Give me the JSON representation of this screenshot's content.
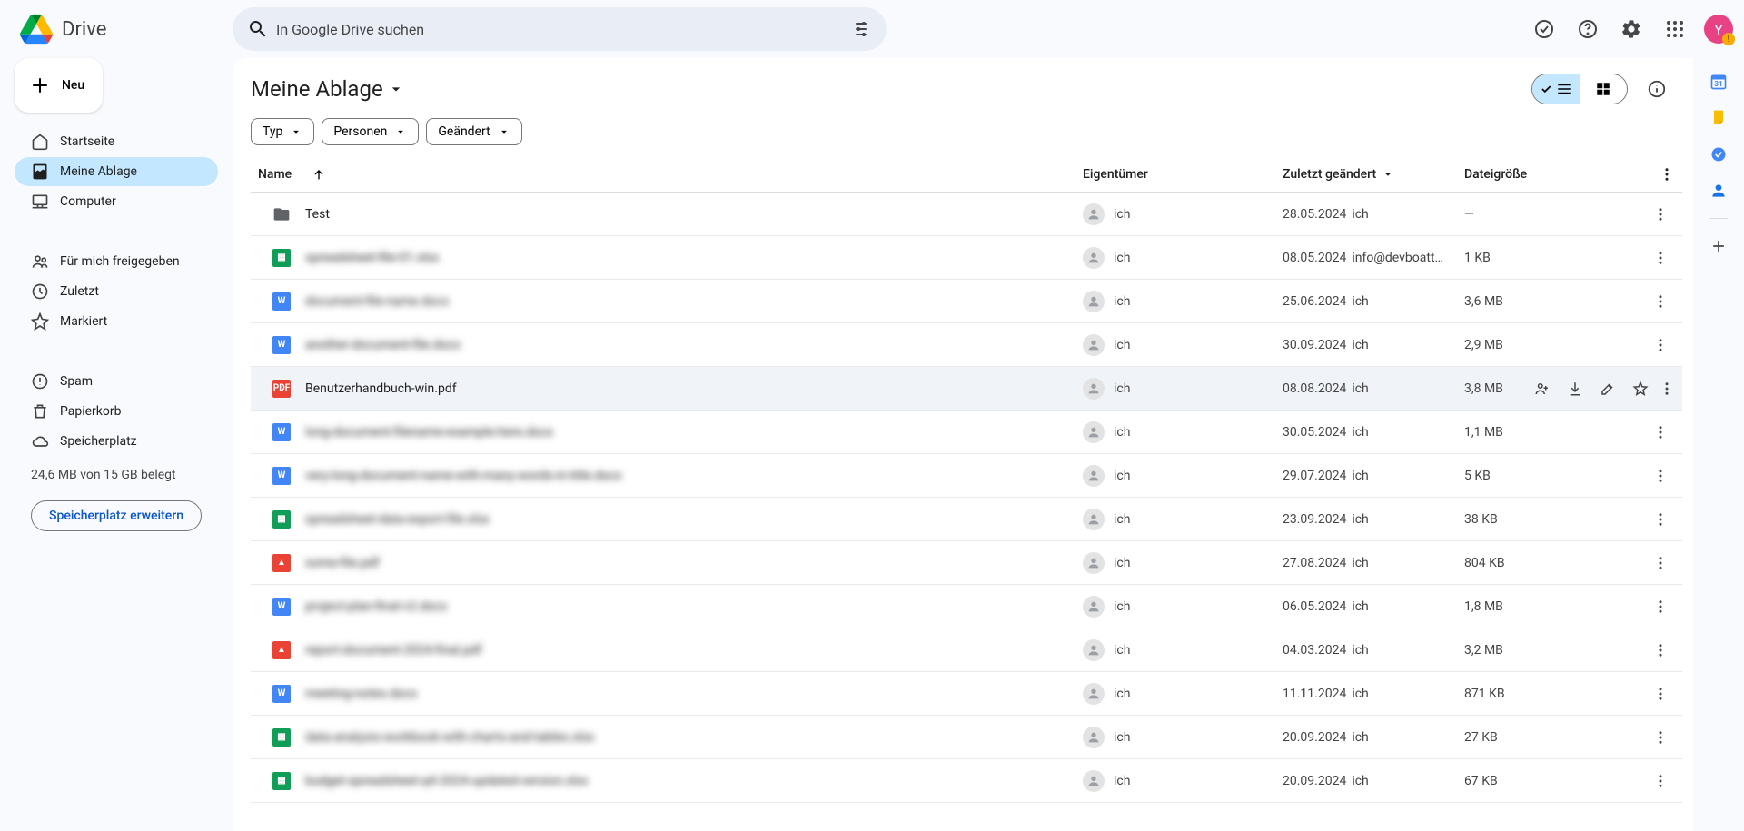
{
  "app": {
    "name": "Drive"
  },
  "search": {
    "placeholder": "In Google Drive suchen"
  },
  "newButton": "Neu",
  "nav": {
    "home": "Startseite",
    "mydrive": "Meine Ablage",
    "computers": "Computer",
    "shared": "Für mich freigegeben",
    "recent": "Zuletzt",
    "starred": "Markiert",
    "spam": "Spam",
    "trash": "Papierkorb",
    "storage": "Speicherplatz"
  },
  "storage": {
    "usage": "24,6 MB von 15 GB belegt",
    "cta": "Speicherplatz erweitern"
  },
  "breadcrumb": "Meine Ablage",
  "filters": {
    "type": "Typ",
    "people": "Personen",
    "modified": "Geändert"
  },
  "columns": {
    "name": "Name",
    "owner": "Eigentümer",
    "modified": "Zuletzt geändert",
    "size": "Dateigröße"
  },
  "rows": [
    {
      "icon": "folder",
      "name": "Test",
      "owner": "ich",
      "modDate": "28.05.2024",
      "modBy": "ich",
      "size": "—",
      "blur": false
    },
    {
      "icon": "sheet",
      "name": "spreadsheet-file-01.xlsx",
      "owner": "ich",
      "modDate": "08.05.2024",
      "modBy": "info@devboatt…",
      "size": "1 KB",
      "blur": true
    },
    {
      "icon": "docblue",
      "name": "document-file-name.docx",
      "owner": "ich",
      "modDate": "25.06.2024",
      "modBy": "ich",
      "size": "3,6 MB",
      "blur": true
    },
    {
      "icon": "docblue",
      "name": "another-document-file.docx",
      "owner": "ich",
      "modDate": "30.09.2024",
      "modBy": "ich",
      "size": "2,9 MB",
      "blur": true
    },
    {
      "icon": "pdf",
      "name": "Benutzerhandbuch-win.pdf",
      "owner": "ich",
      "modDate": "08.08.2024",
      "modBy": "ich",
      "size": "3,8 MB",
      "blur": false,
      "hovered": true
    },
    {
      "icon": "docblue",
      "name": "long-document-filename-example-here.docx",
      "owner": "ich",
      "modDate": "30.05.2024",
      "modBy": "ich",
      "size": "1,1 MB",
      "blur": true
    },
    {
      "icon": "docblue",
      "name": "very-long-document-name-with-many-words-in-title.docx",
      "owner": "ich",
      "modDate": "29.07.2024",
      "modBy": "ich",
      "size": "5 KB",
      "blur": true
    },
    {
      "icon": "sheet",
      "name": "spreadsheet-data-export-file.xlsx",
      "owner": "ich",
      "modDate": "23.09.2024",
      "modBy": "ich",
      "size": "38 KB",
      "blur": true
    },
    {
      "icon": "pdfred",
      "name": "some-file.pdf",
      "owner": "ich",
      "modDate": "27.08.2024",
      "modBy": "ich",
      "size": "804 KB",
      "blur": true
    },
    {
      "icon": "docblue",
      "name": "project-plan-final-v2.docx",
      "owner": "ich",
      "modDate": "06.05.2024",
      "modBy": "ich",
      "size": "1,8 MB",
      "blur": true
    },
    {
      "icon": "pdfred",
      "name": "report-document-2024-final.pdf",
      "owner": "ich",
      "modDate": "04.03.2024",
      "modBy": "ich",
      "size": "3,2 MB",
      "blur": true
    },
    {
      "icon": "docblue",
      "name": "meeting-notes.docx",
      "owner": "ich",
      "modDate": "11.11.2024",
      "modBy": "ich",
      "size": "871 KB",
      "blur": true
    },
    {
      "icon": "sheet",
      "name": "data-analysis-workbook-with-charts-and-tables.xlsx",
      "owner": "ich",
      "modDate": "20.09.2024",
      "modBy": "ich",
      "size": "27 KB",
      "blur": true
    },
    {
      "icon": "sheet",
      "name": "budget-spreadsheet-q4-2024-updated-version.xlsx",
      "owner": "ich",
      "modDate": "20.09.2024",
      "modBy": "ich",
      "size": "67 KB",
      "blur": true
    }
  ],
  "avatar": {
    "initial": "Y",
    "alert": "!"
  }
}
